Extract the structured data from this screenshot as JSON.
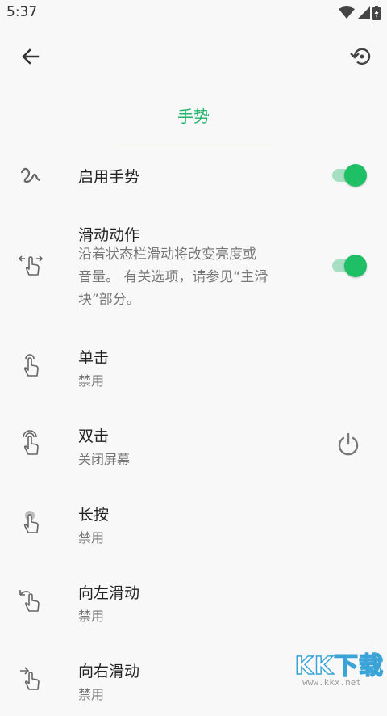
{
  "status_bar": {
    "time": "5:37"
  },
  "toolbar": {
    "back_icon": "arrow-left-icon",
    "restore_icon": "restore-icon"
  },
  "tab": {
    "title": "手势",
    "accent_color": "#22b56a"
  },
  "settings": {
    "enable": {
      "icon": "squiggle-gesture-icon",
      "title": "启用手势",
      "toggle_on": true
    },
    "swipe_action": {
      "icon": "swipe-horizontal-icon",
      "title": "滑动动作",
      "desc_line1": "沿着状态栏滑动将改变亮度或",
      "desc_line2": "音量。 有关选项，请参见“主滑",
      "desc_line3": "块”部分。",
      "toggle_on": true
    },
    "items": [
      {
        "icon": "tap-icon",
        "title": "单击",
        "subtitle": "禁用"
      },
      {
        "icon": "double-tap-icon",
        "title": "双击",
        "subtitle": "关闭屏幕",
        "action_icon": "power-icon"
      },
      {
        "icon": "long-press-icon",
        "title": "长按",
        "subtitle": "禁用"
      },
      {
        "icon": "swipe-left-icon",
        "title": "向左滑动",
        "subtitle": "禁用"
      },
      {
        "icon": "swipe-right-icon",
        "title": "向右滑动",
        "subtitle": "禁用"
      }
    ]
  },
  "watermark": {
    "logo": "KK下载",
    "url": "www.kkx.net"
  }
}
